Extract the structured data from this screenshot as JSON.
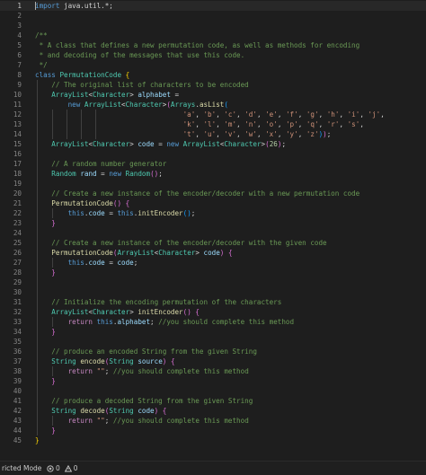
{
  "editor": {
    "language": "Java",
    "active_line": 1,
    "lines": [
      {
        "n": "1",
        "t": [
          [
            "import",
            "kw"
          ],
          [
            " java.util.*;",
            "pl"
          ]
        ]
      },
      {
        "n": "2",
        "t": []
      },
      {
        "n": "3",
        "t": []
      },
      {
        "n": "4",
        "t": [
          [
            "/**",
            "cm"
          ]
        ]
      },
      {
        "n": "5",
        "t": [
          [
            " * A class that defines a new permutation code, as well as methods for encoding",
            "cm"
          ]
        ]
      },
      {
        "n": "6",
        "t": [
          [
            " * and decoding of the messages that use this code.",
            "cm"
          ]
        ]
      },
      {
        "n": "7",
        "t": [
          [
            " */",
            "cm"
          ]
        ]
      },
      {
        "n": "8",
        "t": [
          [
            "class",
            "kw"
          ],
          [
            " ",
            "pl"
          ],
          [
            "PermutationCode",
            "ty"
          ],
          [
            " ",
            "pl"
          ],
          [
            "{",
            "br1"
          ]
        ]
      },
      {
        "n": "9",
        "t": [
          [
            "    ",
            "pl"
          ],
          [
            "// The original list of characters to be encoded",
            "cm"
          ]
        ]
      },
      {
        "n": "10",
        "t": [
          [
            "    ",
            "pl"
          ],
          [
            "ArrayList",
            "ty"
          ],
          [
            "<",
            "pl"
          ],
          [
            "Character",
            "ty"
          ],
          [
            "> ",
            "pl"
          ],
          [
            "alphabet",
            "var"
          ],
          [
            " =",
            "pl"
          ]
        ]
      },
      {
        "n": "11",
        "t": [
          [
            "        ",
            "pl"
          ],
          [
            "new",
            "kw"
          ],
          [
            " ",
            "pl"
          ],
          [
            "ArrayList",
            "ty"
          ],
          [
            "<",
            "pl"
          ],
          [
            "Character",
            "ty"
          ],
          [
            ">",
            "pl"
          ],
          [
            "(",
            "br2"
          ],
          [
            "Arrays",
            "ty"
          ],
          [
            ".",
            "pl"
          ],
          [
            "asList",
            "fn"
          ],
          [
            "(",
            "br3"
          ]
        ]
      },
      {
        "n": "12",
        "t": [
          [
            "                                    ",
            "pl"
          ],
          [
            "'a'",
            "str"
          ],
          [
            ", ",
            "pl"
          ],
          [
            "'b'",
            "str"
          ],
          [
            ", ",
            "pl"
          ],
          [
            "'c'",
            "str"
          ],
          [
            ", ",
            "pl"
          ],
          [
            "'d'",
            "str"
          ],
          [
            ", ",
            "pl"
          ],
          [
            "'e'",
            "str"
          ],
          [
            ", ",
            "pl"
          ],
          [
            "'f'",
            "str"
          ],
          [
            ", ",
            "pl"
          ],
          [
            "'g'",
            "str"
          ],
          [
            ", ",
            "pl"
          ],
          [
            "'h'",
            "str"
          ],
          [
            ", ",
            "pl"
          ],
          [
            "'i'",
            "str"
          ],
          [
            ", ",
            "pl"
          ],
          [
            "'j'",
            "str"
          ],
          [
            ",",
            "pl"
          ]
        ]
      },
      {
        "n": "13",
        "t": [
          [
            "                                    ",
            "pl"
          ],
          [
            "'k'",
            "str"
          ],
          [
            ", ",
            "pl"
          ],
          [
            "'l'",
            "str"
          ],
          [
            ", ",
            "pl"
          ],
          [
            "'m'",
            "str"
          ],
          [
            ", ",
            "pl"
          ],
          [
            "'n'",
            "str"
          ],
          [
            ", ",
            "pl"
          ],
          [
            "'o'",
            "str"
          ],
          [
            ", ",
            "pl"
          ],
          [
            "'p'",
            "str"
          ],
          [
            ", ",
            "pl"
          ],
          [
            "'q'",
            "str"
          ],
          [
            ", ",
            "pl"
          ],
          [
            "'r'",
            "str"
          ],
          [
            ", ",
            "pl"
          ],
          [
            "'s'",
            "str"
          ],
          [
            ",",
            "pl"
          ]
        ]
      },
      {
        "n": "14",
        "t": [
          [
            "                                    ",
            "pl"
          ],
          [
            "'t'",
            "str"
          ],
          [
            ", ",
            "pl"
          ],
          [
            "'u'",
            "str"
          ],
          [
            ", ",
            "pl"
          ],
          [
            "'v'",
            "str"
          ],
          [
            ", ",
            "pl"
          ],
          [
            "'w'",
            "str"
          ],
          [
            ", ",
            "pl"
          ],
          [
            "'x'",
            "str"
          ],
          [
            ", ",
            "pl"
          ],
          [
            "'y'",
            "str"
          ],
          [
            ", ",
            "pl"
          ],
          [
            "'z'",
            "str"
          ],
          [
            ")",
            "br3"
          ],
          [
            ")",
            "br2"
          ],
          [
            ";",
            "pl"
          ]
        ]
      },
      {
        "n": "15",
        "t": [
          [
            "    ",
            "pl"
          ],
          [
            "ArrayList",
            "ty"
          ],
          [
            "<",
            "pl"
          ],
          [
            "Character",
            "ty"
          ],
          [
            "> ",
            "pl"
          ],
          [
            "code",
            "var"
          ],
          [
            " = ",
            "pl"
          ],
          [
            "new",
            "kw"
          ],
          [
            " ",
            "pl"
          ],
          [
            "ArrayList",
            "ty"
          ],
          [
            "<",
            "pl"
          ],
          [
            "Character",
            "ty"
          ],
          [
            ">",
            "pl"
          ],
          [
            "(",
            "br2"
          ],
          [
            "26",
            "num"
          ],
          [
            ")",
            "br2"
          ],
          [
            ";",
            "pl"
          ]
        ]
      },
      {
        "n": "16",
        "t": []
      },
      {
        "n": "17",
        "t": [
          [
            "    ",
            "pl"
          ],
          [
            "// A random number generator",
            "cm"
          ]
        ]
      },
      {
        "n": "18",
        "t": [
          [
            "    ",
            "pl"
          ],
          [
            "Random",
            "ty"
          ],
          [
            " ",
            "pl"
          ],
          [
            "rand",
            "var"
          ],
          [
            " = ",
            "pl"
          ],
          [
            "new",
            "kw"
          ],
          [
            " ",
            "pl"
          ],
          [
            "Random",
            "ty"
          ],
          [
            "()",
            "br2"
          ],
          [
            ";",
            "pl"
          ]
        ]
      },
      {
        "n": "19",
        "t": []
      },
      {
        "n": "20",
        "t": [
          [
            "    ",
            "pl"
          ],
          [
            "// Create a new instance of the encoder/decoder with a new permutation code",
            "cm"
          ]
        ]
      },
      {
        "n": "21",
        "t": [
          [
            "    ",
            "pl"
          ],
          [
            "PermutationCode",
            "fn"
          ],
          [
            "()",
            "br2"
          ],
          [
            " ",
            "pl"
          ],
          [
            "{",
            "br2"
          ]
        ]
      },
      {
        "n": "22",
        "t": [
          [
            "        ",
            "pl"
          ],
          [
            "this",
            "kw"
          ],
          [
            ".",
            "pl"
          ],
          [
            "code",
            "var"
          ],
          [
            " = ",
            "pl"
          ],
          [
            "this",
            "kw"
          ],
          [
            ".",
            "pl"
          ],
          [
            "initEncoder",
            "fn"
          ],
          [
            "()",
            "br3"
          ],
          [
            ";",
            "pl"
          ]
        ]
      },
      {
        "n": "23",
        "t": [
          [
            "    ",
            "pl"
          ],
          [
            "}",
            "br2"
          ]
        ]
      },
      {
        "n": "24",
        "t": []
      },
      {
        "n": "25",
        "t": [
          [
            "    ",
            "pl"
          ],
          [
            "// Create a new instance of the encoder/decoder with the given code",
            "cm"
          ]
        ]
      },
      {
        "n": "26",
        "t": [
          [
            "    ",
            "pl"
          ],
          [
            "PermutationCode",
            "fn"
          ],
          [
            "(",
            "br2"
          ],
          [
            "ArrayList",
            "ty"
          ],
          [
            "<",
            "pl"
          ],
          [
            "Character",
            "ty"
          ],
          [
            "> ",
            "pl"
          ],
          [
            "code",
            "var"
          ],
          [
            ")",
            "br2"
          ],
          [
            " ",
            "pl"
          ],
          [
            "{",
            "br2"
          ]
        ]
      },
      {
        "n": "27",
        "t": [
          [
            "        ",
            "pl"
          ],
          [
            "this",
            "kw"
          ],
          [
            ".",
            "pl"
          ],
          [
            "code",
            "var"
          ],
          [
            " = ",
            "pl"
          ],
          [
            "code",
            "var"
          ],
          [
            ";",
            "pl"
          ]
        ]
      },
      {
        "n": "28",
        "t": [
          [
            "    ",
            "pl"
          ],
          [
            "}",
            "br2"
          ]
        ]
      },
      {
        "n": "29",
        "t": []
      },
      {
        "n": "30",
        "t": []
      },
      {
        "n": "31",
        "t": [
          [
            "    ",
            "pl"
          ],
          [
            "// Initialize the encoding permutation of the characters",
            "cm"
          ]
        ]
      },
      {
        "n": "32",
        "t": [
          [
            "    ",
            "pl"
          ],
          [
            "ArrayList",
            "ty"
          ],
          [
            "<",
            "pl"
          ],
          [
            "Character",
            "ty"
          ],
          [
            "> ",
            "pl"
          ],
          [
            "initEncoder",
            "fn"
          ],
          [
            "()",
            "br2"
          ],
          [
            " ",
            "pl"
          ],
          [
            "{",
            "br2"
          ]
        ]
      },
      {
        "n": "33",
        "t": [
          [
            "        ",
            "pl"
          ],
          [
            "return",
            "ctl"
          ],
          [
            " ",
            "pl"
          ],
          [
            "this",
            "kw"
          ],
          [
            ".",
            "pl"
          ],
          [
            "alphabet",
            "var"
          ],
          [
            "; ",
            "pl"
          ],
          [
            "//you should complete this method",
            "cm"
          ]
        ]
      },
      {
        "n": "34",
        "t": [
          [
            "    ",
            "pl"
          ],
          [
            "}",
            "br2"
          ]
        ]
      },
      {
        "n": "35",
        "t": []
      },
      {
        "n": "36",
        "t": [
          [
            "    ",
            "pl"
          ],
          [
            "// produce an encoded String from the given String",
            "cm"
          ]
        ]
      },
      {
        "n": "37",
        "t": [
          [
            "    ",
            "pl"
          ],
          [
            "String",
            "ty"
          ],
          [
            " ",
            "pl"
          ],
          [
            "encode",
            "fn"
          ],
          [
            "(",
            "br2"
          ],
          [
            "String",
            "ty"
          ],
          [
            " ",
            "pl"
          ],
          [
            "source",
            "var"
          ],
          [
            ")",
            "br2"
          ],
          [
            " ",
            "pl"
          ],
          [
            "{",
            "br2"
          ]
        ]
      },
      {
        "n": "38",
        "t": [
          [
            "        ",
            "pl"
          ],
          [
            "return",
            "ctl"
          ],
          [
            " ",
            "pl"
          ],
          [
            "\"\"",
            "str"
          ],
          [
            "; ",
            "pl"
          ],
          [
            "//you should complete this method",
            "cm"
          ]
        ]
      },
      {
        "n": "39",
        "t": [
          [
            "    ",
            "pl"
          ],
          [
            "}",
            "br2"
          ]
        ]
      },
      {
        "n": "40",
        "t": []
      },
      {
        "n": "41",
        "t": [
          [
            "    ",
            "pl"
          ],
          [
            "// produce a decoded String from the given String",
            "cm"
          ]
        ]
      },
      {
        "n": "42",
        "t": [
          [
            "    ",
            "pl"
          ],
          [
            "String",
            "ty"
          ],
          [
            " ",
            "pl"
          ],
          [
            "decode",
            "fn"
          ],
          [
            "(",
            "br2"
          ],
          [
            "String",
            "ty"
          ],
          [
            " ",
            "pl"
          ],
          [
            "code",
            "var"
          ],
          [
            ")",
            "br2"
          ],
          [
            " ",
            "pl"
          ],
          [
            "{",
            "br2"
          ]
        ]
      },
      {
        "n": "43",
        "t": [
          [
            "        ",
            "pl"
          ],
          [
            "return",
            "ctl"
          ],
          [
            " ",
            "pl"
          ],
          [
            "\"\"",
            "str"
          ],
          [
            "; ",
            "pl"
          ],
          [
            "//you should complete this method",
            "cm"
          ]
        ]
      },
      {
        "n": "44",
        "t": [
          [
            "    ",
            "pl"
          ],
          [
            "}",
            "br2"
          ]
        ]
      },
      {
        "n": "45",
        "t": [
          [
            "}",
            "br1"
          ]
        ]
      }
    ]
  },
  "statusbar": {
    "restricted_label": "ricted Mode",
    "errors_icon": "error-circle-icon",
    "errors_count": "0",
    "warnings_icon": "warning-triangle-icon",
    "warnings_count": "0"
  },
  "colors": {
    "background": "#1e1e1e",
    "keyword": "#569cd6",
    "control": "#c586c0",
    "comment": "#6a9955",
    "type": "#4ec9b0",
    "function": "#dcdcaa",
    "variable": "#9cdcfe",
    "string": "#ce9178",
    "number": "#b5cea8",
    "bracket_1": "#ffd700",
    "bracket_2": "#da70d6",
    "bracket_3": "#179fff"
  }
}
